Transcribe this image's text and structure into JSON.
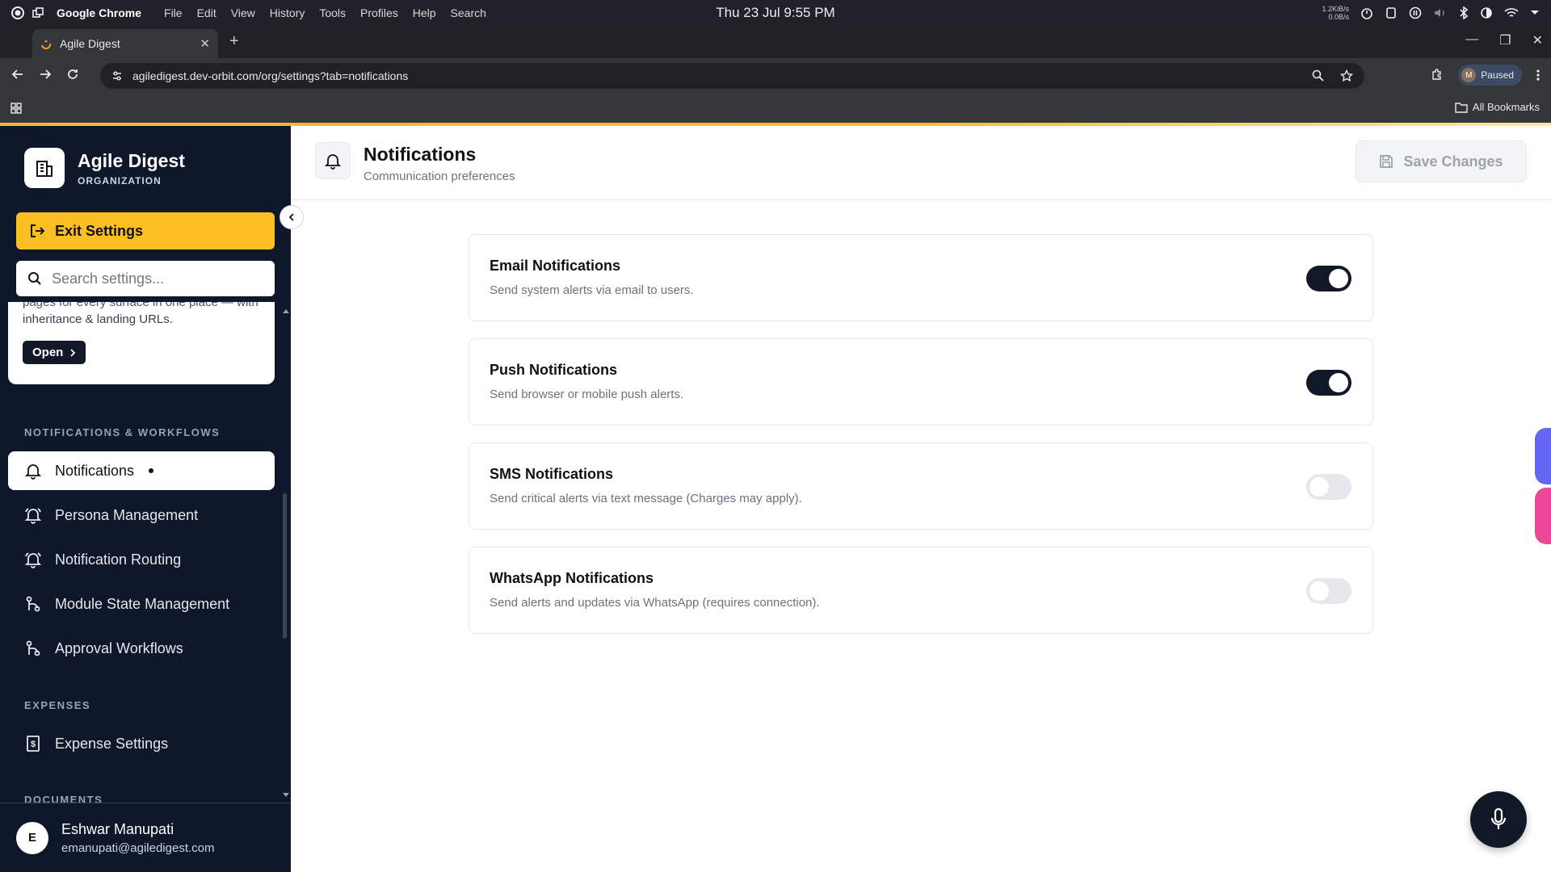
{
  "os": {
    "app_name": "Google Chrome",
    "menu": [
      "File",
      "Edit",
      "View",
      "History",
      "Tools",
      "Profiles",
      "Help",
      "Search"
    ],
    "clock": "Thu 23 Jul  9:55 PM",
    "net_up": "1.2KiB/s",
    "net_down": "0.0B/s"
  },
  "browser": {
    "tab_title": "Agile Digest",
    "url": "agiledigest.dev-orbit.com/org/settings?tab=notifications",
    "profile_initial": "M",
    "profile_status": "Paused",
    "bookmarks_label": "All Bookmarks"
  },
  "sidebar": {
    "org_name": "Agile Digest",
    "org_type": "ORGANIZATION",
    "exit_label": "Exit Settings",
    "search_placeholder": "Search settings...",
    "promo": {
      "cut_text": "pages for every surface in one place — with",
      "desc": "inheritance & landing URLs.",
      "open_label": "Open"
    },
    "sections": [
      {
        "title": "NOTIFICATIONS & WORKFLOWS",
        "items": [
          {
            "label": "Notifications",
            "icon": "bell-icon",
            "active": true
          },
          {
            "label": "Persona Management",
            "icon": "bell-ring-icon"
          },
          {
            "label": "Notification Routing",
            "icon": "bell-ring-icon"
          },
          {
            "label": "Module State Management",
            "icon": "git-branch-icon"
          },
          {
            "label": "Approval Workflows",
            "icon": "git-branch-icon"
          }
        ]
      },
      {
        "title": "EXPENSES",
        "items": [
          {
            "label": "Expense Settings",
            "icon": "receipt-icon"
          }
        ]
      },
      {
        "title": "DOCUMENTS",
        "items": []
      }
    ],
    "user": {
      "initial": "E",
      "name": "Eshwar Manupati",
      "email": "emanupati@agiledigest.com"
    }
  },
  "main": {
    "title": "Notifications",
    "subtitle": "Communication preferences",
    "save_label": "Save Changes",
    "cards": [
      {
        "title": "Email Notifications",
        "desc": "Send system alerts via email to users.",
        "enabled": true
      },
      {
        "title": "Push Notifications",
        "desc": "Send browser or mobile push alerts.",
        "enabled": true
      },
      {
        "title": "SMS Notifications",
        "desc": "Send critical alerts via text message (Charges may apply).",
        "enabled": false
      },
      {
        "title": "WhatsApp Notifications",
        "desc": "Send alerts and updates via WhatsApp (requires connection).",
        "enabled": false
      }
    ]
  },
  "colors": {
    "accent": "#fbbf24",
    "sidebar_bg": "#0f172a",
    "toggle_on": "#111827",
    "toggle_off": "#e5e7eb"
  }
}
